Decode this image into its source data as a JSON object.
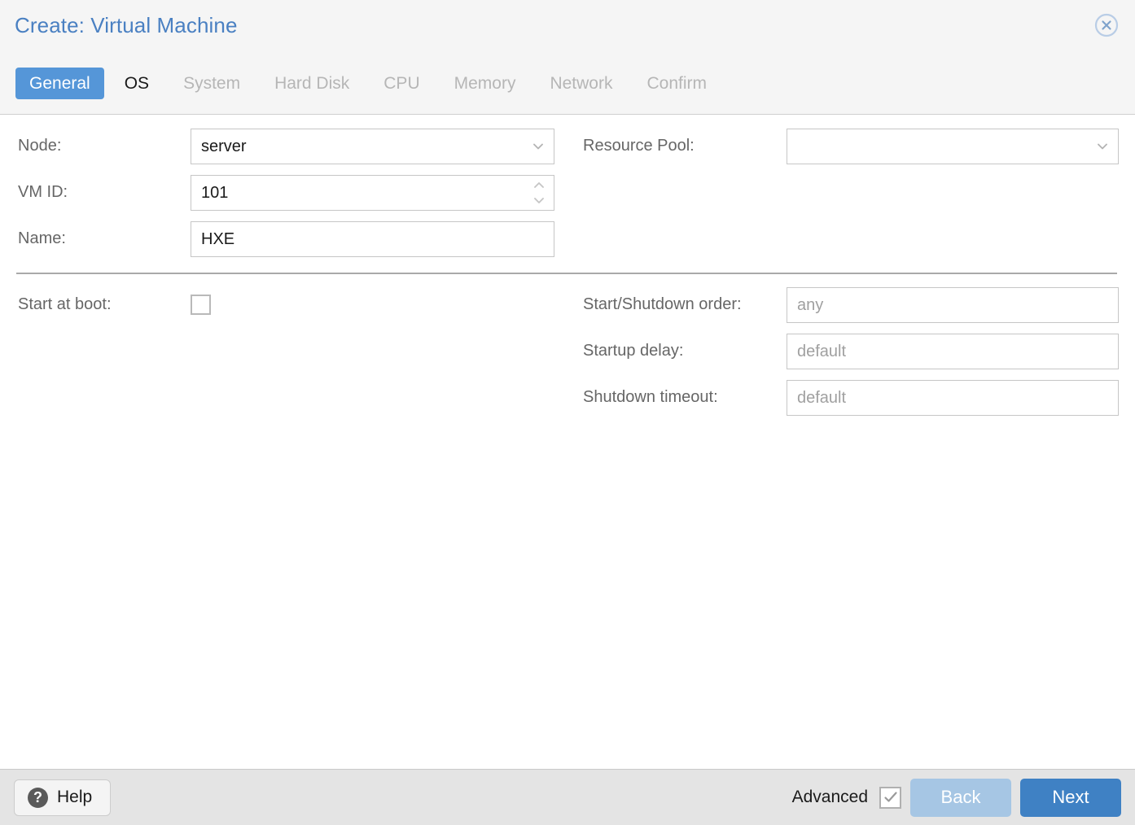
{
  "dialog": {
    "title": "Create: Virtual Machine",
    "close_icon": "close-circle-icon"
  },
  "tabs": [
    {
      "label": "General",
      "state": "active"
    },
    {
      "label": "OS",
      "state": "enabled"
    },
    {
      "label": "System",
      "state": "disabled"
    },
    {
      "label": "Hard Disk",
      "state": "disabled"
    },
    {
      "label": "CPU",
      "state": "disabled"
    },
    {
      "label": "Memory",
      "state": "disabled"
    },
    {
      "label": "Network",
      "state": "disabled"
    },
    {
      "label": "Confirm",
      "state": "disabled"
    }
  ],
  "form": {
    "left": {
      "node": {
        "label": "Node:",
        "value": "server",
        "control": "dropdown"
      },
      "vmid": {
        "label": "VM ID:",
        "value": "101",
        "control": "spinner"
      },
      "name": {
        "label": "Name:",
        "value": "HXE",
        "control": "text"
      },
      "start_at_boot": {
        "label": "Start at boot:",
        "checked": false,
        "control": "checkbox"
      }
    },
    "right": {
      "resource_pool": {
        "label": "Resource Pool:",
        "value": "",
        "control": "dropdown"
      },
      "start_shutdown_order": {
        "label": "Start/Shutdown order:",
        "placeholder": "any",
        "value": "",
        "control": "text"
      },
      "startup_delay": {
        "label": "Startup delay:",
        "placeholder": "default",
        "value": "",
        "control": "text"
      },
      "shutdown_timeout": {
        "label": "Shutdown timeout:",
        "placeholder": "default",
        "value": "",
        "control": "text"
      }
    }
  },
  "footer": {
    "help_label": "Help",
    "help_icon": "question-mark-icon",
    "advanced_label": "Advanced",
    "advanced_checked": true,
    "back_label": "Back",
    "next_label": "Next"
  },
  "colors": {
    "accent_blue": "#5596d8",
    "title_blue": "#4a80c2",
    "next_button": "#3f81c4",
    "back_button_disabled": "#a6c6e4",
    "header_bg": "#f5f5f5",
    "footer_bg": "#e4e4e4"
  }
}
